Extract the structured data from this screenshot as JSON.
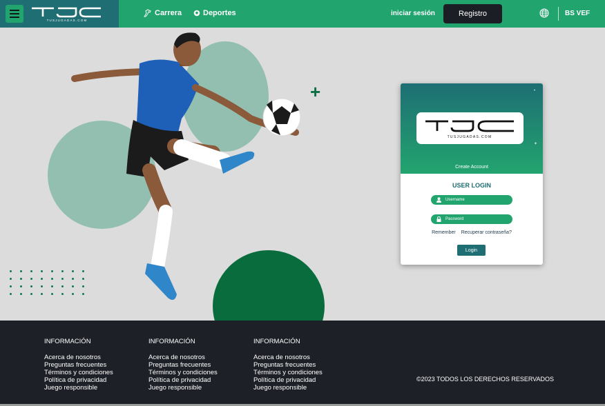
{
  "header": {
    "logo_text": "TJC",
    "logo_tagline": "TUSJUGADAS.COM",
    "nav": [
      {
        "label": "Carrera",
        "icon": "horse-icon"
      },
      {
        "label": "Deportes",
        "icon": "soccer-ball-icon"
      }
    ],
    "login_label": "iniciar sesión",
    "register_label": "Registro",
    "currency": "BS VEF"
  },
  "login_card": {
    "logo_text": "TJC",
    "logo_tagline": "TUSJUGADAS.COM",
    "create_account": "Create Account",
    "title": "USER LOGIN",
    "username_placeholder": "Username",
    "password_placeholder": "Password",
    "remember_label": "Remember",
    "recover_label": "Recuperar contraseña?",
    "login_button": "Login"
  },
  "footer": {
    "columns": [
      {
        "title": "INFORMACIÓN",
        "links": [
          "Acerca de nosotros",
          "Preguntas frecuentes",
          "Términos y condiciones",
          "Política de privacidad",
          "Juego responsible"
        ]
      },
      {
        "title": "INFORMACIÓN",
        "links": [
          "Acerca de nosotros",
          "Preguntas frecuentes",
          "Términos y condiciones",
          "Política de privacidad",
          "Juego responsible"
        ]
      },
      {
        "title": "INFORMACIÓN",
        "links": [
          "Acerca de nosotros",
          "Preguntas frecuentes",
          "Términos y condiciones",
          "Política de privacidad",
          "Juego responsible"
        ]
      }
    ],
    "copyright": "©2023 TODOS LOS DERECHOS RESERVADOS"
  },
  "colors": {
    "header_green": "#22a46f",
    "logo_teal": "#1e6e73",
    "dark": "#1e2027",
    "circle_light": "#93bfb0",
    "circle_dark": "#086c3c"
  }
}
